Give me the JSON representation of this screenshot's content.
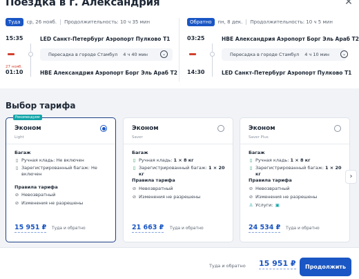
{
  "header": {
    "title": "Поездка в г. Александрия",
    "close_glyph": "✕"
  },
  "outbound": {
    "badge": "Туда",
    "date": "ср, 26 нояб.",
    "duration": "Продолжительность: 10 ч 35 мин",
    "dep_time": "15:35",
    "dep_airport": "LED Санкт-Петербург Аэропорт Пулково Т1",
    "transfer_city": "Пересадка в городе Стамбул",
    "transfer_time": "4 ч 40 мин",
    "arr_next_day": "27 нояб.",
    "arr_time": "01:10",
    "arr_airport": "HBE Александрия Аэропорт Борг Эль Араб Т2"
  },
  "inbound": {
    "badge": "Обратно",
    "date": "пн, 8 дек.",
    "duration": "Продолжительность: 10 ч 5 мин",
    "dep_time": "03:25",
    "dep_airport": "HBE Александрия Аэропорт Борг Эль Араб Т2",
    "transfer_city": "Пересадка в городе Стамбул",
    "transfer_time": "4 ч 10 мин",
    "arr_time": "14:30",
    "arr_airport": "LED Санкт-Петербург Аэропорт Пулково Т1"
  },
  "tariffs": {
    "title": "Выбор тарифа",
    "baggage_heading": "Багаж",
    "rules_heading": "Правила тарифа",
    "price_note": "Туда и обратно",
    "cards": [
      {
        "recommended": "Рекомендуем",
        "name": "Эконом",
        "sub": "Light",
        "selected": true,
        "hand": "Ручная кладь: Не включен",
        "checked": "Зарегистрированный багаж: Не включен",
        "refund": "Невозвратный",
        "changes": "Изменения не разрешены",
        "price": "15 951 ₽"
      },
      {
        "name": "Эконом",
        "sub": "Saver",
        "selected": false,
        "hand_label": "Ручная кладь:",
        "hand_value": "1 × 8 кг",
        "checked_label": "Зарегистрированный багаж:",
        "checked_value": "1 × 20 кг",
        "refund": "Невозвратный",
        "changes": "Изменения не разрешены",
        "price": "21 663 ₽"
      },
      {
        "name": "Эконом",
        "sub": "Saver Plus",
        "selected": false,
        "hand_label": "Ручная кладь:",
        "hand_value": "1 × 8 кг",
        "checked_label": "Зарегистрированный багаж:",
        "checked_value": "1 × 20 кг",
        "refund": "Невозвратный",
        "changes": "Изменения не разрешены",
        "services": "Услуги:",
        "price": "24 534 ₽"
      }
    ]
  },
  "footer": {
    "total_label": "Туда и обратно",
    "total_price": "15 951 ₽",
    "continue_label": "Продолжить"
  },
  "colors": {
    "accent": "#1a56c4",
    "selected_border": "#1a3f86",
    "recommend_badge": "#13a5a8",
    "next_day": "#d2402e"
  }
}
